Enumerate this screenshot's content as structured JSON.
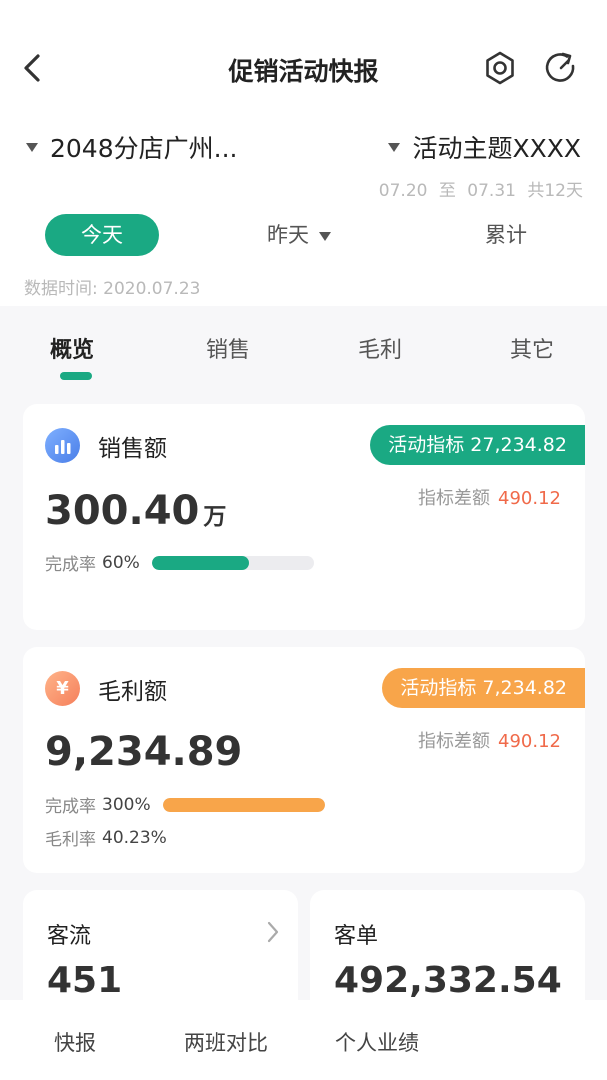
{
  "nav": {
    "title": "促销活动快报",
    "back_icon": "chevron-left-icon",
    "settings_icon": "gear-icon",
    "refresh_icon": "refresh-icon"
  },
  "filters": {
    "store": "2048分店广州...",
    "topic": "活动主题XXXX",
    "period_start": "07.20",
    "period_to": "至",
    "period_end": "07.31",
    "period_days": "共12天",
    "day_tabs": {
      "today": "今天",
      "yesterday": "昨天",
      "total": "累计"
    },
    "data_time": "数据时间: 2020.07.23"
  },
  "tabs": [
    "概览",
    "销售",
    "毛利",
    "其它"
  ],
  "colors": {
    "accent": "#1aa983",
    "orange": "#f8a54a",
    "red": "#f06a4a",
    "blue": "#5b8ef0"
  },
  "sales": {
    "icon": "bar-chart-icon",
    "title": "销售额",
    "badge": "活动指标 27,234.82",
    "diff_label": "指标差额",
    "diff_value": "490.12",
    "value": "300.40",
    "unit": "万",
    "rate_label": "完成率",
    "rate_value": "60%",
    "progress": 0.6
  },
  "gross": {
    "icon": "yen-icon",
    "icon_glyph": "¥",
    "title": "毛利额",
    "badge": "活动指标 7,234.82",
    "diff_label": "指标差额",
    "diff_value": "490.12",
    "value": "9,234.89",
    "rate_label": "完成率",
    "rate_value": "300%",
    "progress": 1.0,
    "margin_label": "毛利率",
    "margin_value": "40.23%"
  },
  "traffic": {
    "label": "客流",
    "value": "451"
  },
  "ticket": {
    "label": "客单",
    "value": "492,332.54"
  },
  "bottom_tabs": [
    "快报",
    "两班对比",
    "个人业绩"
  ]
}
